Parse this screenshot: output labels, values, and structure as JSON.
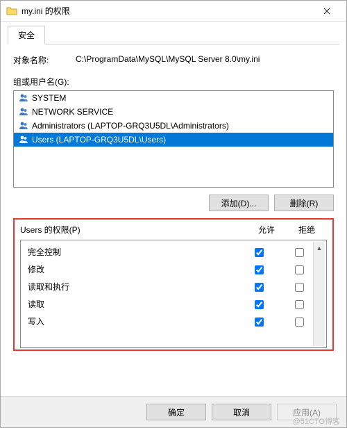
{
  "window": {
    "title": "my.ini 的权限"
  },
  "tabs": {
    "active": "安全"
  },
  "object": {
    "label": "对象名称:",
    "value": "C:\\ProgramData\\MySQL\\MySQL Server 8.0\\my.ini"
  },
  "groups": {
    "label": "组或用户名(G):",
    "items": [
      {
        "name": "SYSTEM",
        "selected": false
      },
      {
        "name": "NETWORK SERVICE",
        "selected": false
      },
      {
        "name": "Administrators (LAPTOP-GRQ3U5DL\\Administrators)",
        "selected": false
      },
      {
        "name": "Users (LAPTOP-GRQ3U5DL\\Users)",
        "selected": true
      }
    ]
  },
  "buttons": {
    "add": "添加(D)...",
    "remove": "删除(R)",
    "ok": "确定",
    "cancel": "取消",
    "apply": "应用(A)"
  },
  "permissions": {
    "title": "Users 的权限(P)",
    "allowLabel": "允许",
    "denyLabel": "拒绝",
    "rows": [
      {
        "name": "完全控制",
        "allow": true,
        "deny": false
      },
      {
        "name": "修改",
        "allow": true,
        "deny": false
      },
      {
        "name": "读取和执行",
        "allow": true,
        "deny": false
      },
      {
        "name": "读取",
        "allow": true,
        "deny": false
      },
      {
        "name": "写入",
        "allow": true,
        "deny": false
      }
    ]
  },
  "watermark": "@51CTO博客"
}
